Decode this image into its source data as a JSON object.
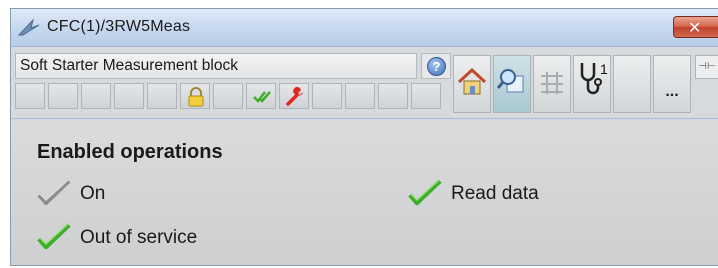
{
  "window": {
    "title": "CFC(1)/3RW5Meas",
    "close_glyph": "✕"
  },
  "toolbar": {
    "block_name": "Soft Starter Measurement block",
    "help_glyph": "?",
    "more_label": "...",
    "diagnostics_superscript": "1",
    "pin_glyph": "⊣⊢"
  },
  "panel": {
    "section_title": "Enabled operations",
    "operations": [
      {
        "label": "On",
        "state": "disabled",
        "icon": "check-grey-icon"
      },
      {
        "label": "Read data",
        "state": "enabled",
        "icon": "check-green-icon"
      },
      {
        "label": "Out of service",
        "state": "enabled",
        "icon": "check-green-icon"
      }
    ]
  },
  "colors": {
    "title_bar": "#c5d7ee",
    "close_button": "#c0402a",
    "check_green": "#3fae2a",
    "check_grey": "#9a9a9a",
    "panel_bg": "#d3d5d7"
  }
}
